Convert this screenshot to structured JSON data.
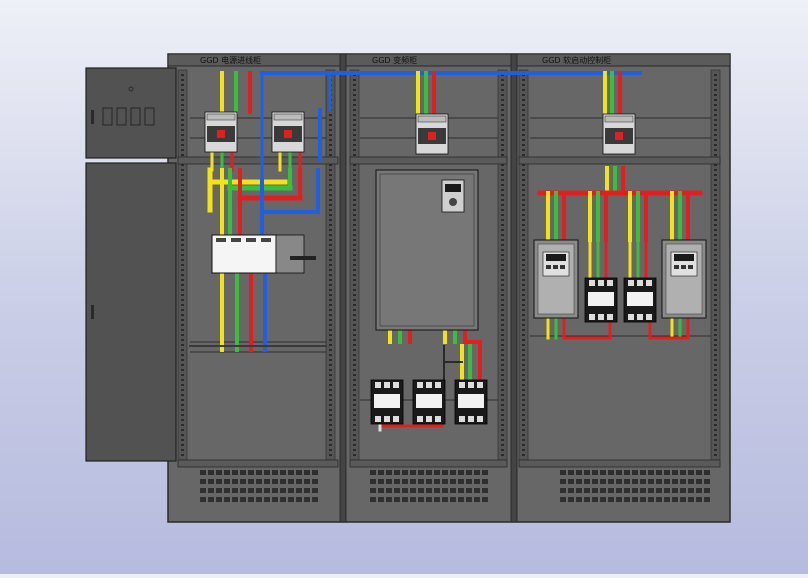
{
  "viewport": {
    "background_top": "#eef0f7",
    "background_bottom": "#b6bbdf"
  },
  "colors": {
    "cabinet": "#6a6a6a",
    "cabinet_dark": "#3d3d3d",
    "door": "#505050",
    "frame": "#4a4a4a",
    "bus_yellow": "#f2e21a",
    "bus_green": "#3bbf3b",
    "bus_red": "#e02020",
    "bus_blue": "#2060e0",
    "device_light": "#d8d8d8",
    "device_dark": "#1a1a1a"
  },
  "sections": [
    {
      "id": "incoming",
      "title": "GGD  电源进线柜"
    },
    {
      "id": "vfd",
      "title": "GGD  变频柜"
    },
    {
      "id": "soft",
      "title": "GGD  软启动控制柜"
    }
  ],
  "icons": {
    "door_handle": "door-handle-icon",
    "vent": "ventilation-grille-icon",
    "breaker": "circuit-breaker-icon",
    "contactor": "contactor-icon",
    "inverter": "frequency-inverter-icon",
    "soft_starter": "soft-starter-icon"
  }
}
